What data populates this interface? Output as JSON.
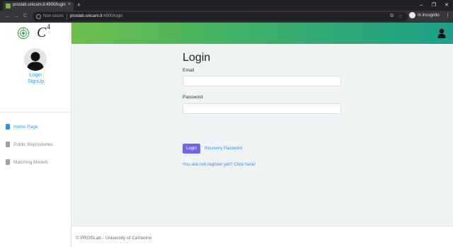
{
  "browser": {
    "tab_title": "proslab.unicam.it:4900/login",
    "tab_close": "×",
    "new_tab": "+",
    "win_min": "–",
    "win_max": "❐",
    "win_close": "✕",
    "back": "←",
    "forward": "→",
    "reload": "C",
    "security_label": "Non sicuro",
    "url_host": "proslab.unicam.it",
    "url_path": ":4900/login",
    "translate_icon": "⧉",
    "star_icon": "☆",
    "incognito_label": "In incognito",
    "menu_icon": "⋮"
  },
  "brand": {
    "logo_text": "C",
    "logo_sup": "4"
  },
  "sidebar": {
    "login_label": "Login",
    "signup_label": "SignUp",
    "items": [
      {
        "label": "Home Page",
        "color": "#2196f3",
        "active": true
      },
      {
        "label": "Public Repositories",
        "color": "#8a8a8a",
        "active": false
      },
      {
        "label": "Matching Models",
        "color": "#8a8a8a",
        "active": false
      }
    ]
  },
  "login": {
    "title": "Login",
    "email_label": "Email",
    "email_value": "",
    "password_label": "Password",
    "password_value": "",
    "submit_label": "Login",
    "recovery_label": "Recovery Password",
    "register_label": "You are not register yet? Click here!"
  },
  "footer": {
    "text": "© PROSLab - University of Camerino"
  },
  "colors": {
    "accent": "#2196f3",
    "button": "#7065e6",
    "header_gradient_start": "#6cc04a",
    "header_gradient_end": "#1d9e8a"
  }
}
